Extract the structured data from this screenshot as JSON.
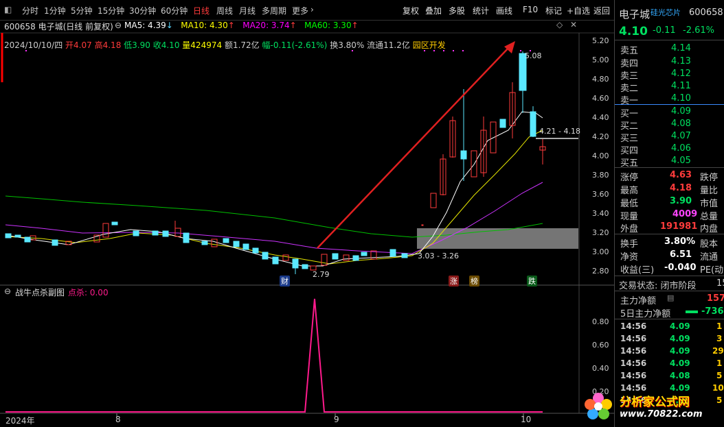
{
  "toolbar": {
    "periods": [
      "分时",
      "1分钟",
      "5分钟",
      "15分钟",
      "30分钟",
      "60分钟",
      "日线",
      "周线",
      "月线",
      "多周期",
      "更多"
    ],
    "active_period": "日线",
    "tools": [
      "复权",
      "叠加",
      "多股",
      "统计",
      "画线",
      "F10",
      "标记",
      "+自选",
      "返回"
    ]
  },
  "main_chart": {
    "title": "600658 电子城(日线 前复权)",
    "ma": [
      {
        "label": "MA5: 4.39",
        "arrow": "↓",
        "color": "#ffffff"
      },
      {
        "label": "MA10: 4.30",
        "arrow": "↑",
        "color": "#ffff00"
      },
      {
        "label": "MA20: 3.74",
        "arrow": "↑",
        "color": "#ff00ff"
      },
      {
        "label": "MA60: 3.30",
        "arrow": "↑",
        "color": "#00ff00"
      }
    ],
    "info": {
      "date": "2024/10/10/四",
      "open": "开4.07",
      "high": "高4.18",
      "low": "低3.90",
      "close": "收4.10",
      "vol": "量424974",
      "amount": "额1.72亿",
      "change": "幅-0.11(-2.61%)",
      "turnover": "换3.80%",
      "float": "流通11.2亿",
      "tag": "园区开发"
    },
    "yticks": [
      "5.20",
      "5.00",
      "4.80",
      "4.60",
      "4.40",
      "4.20",
      "4.00",
      "3.80",
      "3.60",
      "3.40",
      "3.20",
      "3.00",
      "2.80"
    ],
    "annotations": {
      "high": "5.08",
      "range1": "4.21 - 4.18",
      "range2": "3.03 - 3.26",
      "low": "2.79"
    },
    "markers": {
      "cai": "财",
      "zhang": "涨",
      "bang": "榜",
      "die": "跌"
    }
  },
  "sub_chart": {
    "title": "战牛点杀副图",
    "label": "点杀: 0.00",
    "yticks": [
      "0.80",
      "0.60",
      "0.40",
      "0.20"
    ]
  },
  "x_axis": {
    "labels": [
      "2024年",
      "8",
      "9",
      "10"
    ]
  },
  "quote": {
    "name": "电子城",
    "sector": "硅光芯片",
    "code": "600658",
    "price": "4.10",
    "change": "-0.11",
    "pct": "-2.61%",
    "asks": [
      {
        "label": "卖五",
        "price": "4.14"
      },
      {
        "label": "卖四",
        "price": "4.13"
      },
      {
        "label": "卖三",
        "price": "4.12"
      },
      {
        "label": "卖二",
        "price": "4.11"
      },
      {
        "label": "卖一",
        "price": "4.10"
      }
    ],
    "bids": [
      {
        "label": "买一",
        "price": "4.09"
      },
      {
        "label": "买二",
        "price": "4.08"
      },
      {
        "label": "买三",
        "price": "4.07"
      },
      {
        "label": "买四",
        "price": "4.06"
      },
      {
        "label": "买五",
        "price": "4.05"
      }
    ],
    "stats": [
      {
        "l": "涨停",
        "v": "4.63",
        "c": "#ff3b3b",
        "r": "跌停"
      },
      {
        "l": "最高",
        "v": "4.18",
        "c": "#ff3b3b",
        "r": "量比"
      },
      {
        "l": "最低",
        "v": "3.90",
        "c": "#00e060",
        "r": "市值"
      },
      {
        "l": "现量",
        "v": "4009",
        "c": "#ff44ff",
        "r": "总量"
      },
      {
        "l": "外盘",
        "v": "191981",
        "c": "#ff3b3b",
        "r": "内盘"
      }
    ],
    "stats2": [
      {
        "l": "换手",
        "v": "3.80%",
        "c": "#ffffff",
        "r": "股本"
      },
      {
        "l": "净资",
        "v": "6.51",
        "c": "#ffffff",
        "r": "流通"
      },
      {
        "l": "收益(三)",
        "v": "-0.040",
        "c": "#ffffff",
        "r": "PE(动"
      }
    ],
    "status": "交易状态: 闭市阶段",
    "status_num": "15",
    "flow": [
      {
        "l": "主力净额",
        "v": "157",
        "c": "#ff3b3b"
      },
      {
        "l": "5日主力净额",
        "v": "-736",
        "c": "#00e060"
      }
    ],
    "trades": [
      {
        "t": "14:56",
        "p": "4.09",
        "v": "1"
      },
      {
        "t": "14:56",
        "p": "4.09",
        "v": "3"
      },
      {
        "t": "14:56",
        "p": "4.09",
        "v": "29"
      },
      {
        "t": "14:56",
        "p": "4.09",
        "v": "1"
      },
      {
        "t": "14:56",
        "p": "4.08",
        "v": "5"
      },
      {
        "t": "14:56",
        "p": "4.09",
        "v": "10"
      },
      {
        "t": "14:56",
        "p": "4.08",
        "v": "5"
      }
    ]
  },
  "watermark": {
    "text": "分析家公式网",
    "url": "www.70822.com"
  }
}
